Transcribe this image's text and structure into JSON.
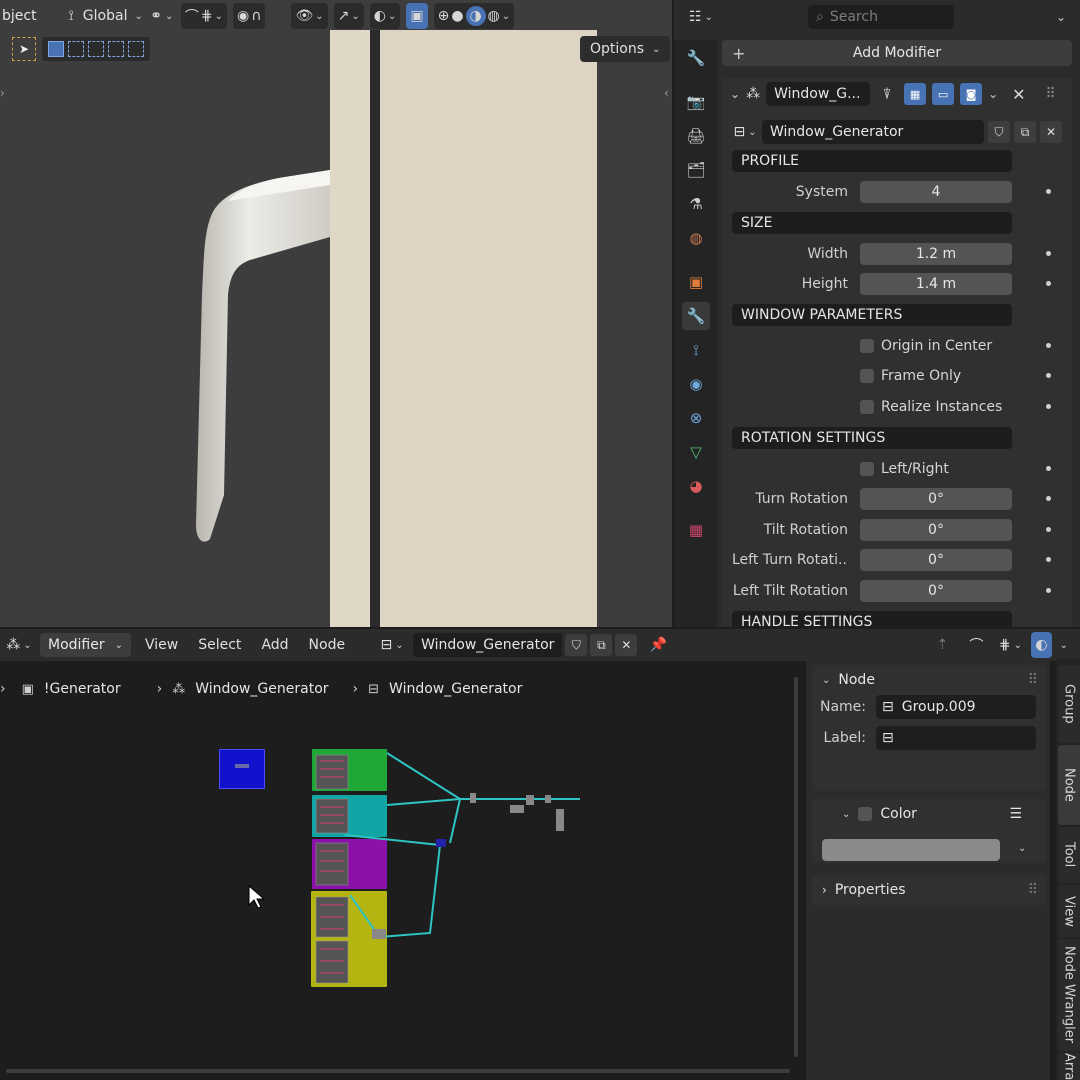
{
  "viewport": {
    "mode_label": "bject",
    "orientation": "Global",
    "options_label": "Options"
  },
  "properties": {
    "search_placeholder": "Search",
    "add_modifier_label": "Add Modifier",
    "modifier_name": "Window_G...",
    "node_group": "Window_Generator",
    "sections": [
      {
        "title": "PROFILE",
        "rows": [
          {
            "label": "System",
            "value": "4",
            "type": "number"
          }
        ]
      },
      {
        "title": "SIZE",
        "rows": [
          {
            "label": "Width",
            "value": "1.2 m",
            "type": "number"
          },
          {
            "label": "Height",
            "value": "1.4 m",
            "type": "number"
          }
        ]
      },
      {
        "title": "WINDOW PARAMETERS",
        "rows": [
          {
            "label": "Origin in Center",
            "type": "checkbox"
          },
          {
            "label": "Frame Only",
            "type": "checkbox"
          },
          {
            "label": "Realize Instances",
            "type": "checkbox"
          }
        ]
      },
      {
        "title": "ROTATION SETTINGS",
        "rows": [
          {
            "label": "Left/Right",
            "type": "checkbox"
          },
          {
            "label": "Turn Rotation",
            "value": "0°",
            "type": "number"
          },
          {
            "label": "Tilt Rotation",
            "value": "0°",
            "type": "number"
          },
          {
            "label": "Left Turn Rotati...",
            "value": "0°",
            "type": "number"
          },
          {
            "label": "Left Tilt Rotation",
            "value": "0°",
            "type": "number"
          }
        ]
      },
      {
        "title": "HANDLE SETTINGS",
        "rows": []
      }
    ]
  },
  "node_editor": {
    "editor_type": "Modifier",
    "menus": [
      "View",
      "Select",
      "Add",
      "Node"
    ],
    "node_group": "Window_Generator",
    "breadcrumb": [
      "!Generator",
      "Window_Generator",
      "Window_Generator"
    ],
    "sidebar": {
      "node_panel_title": "Node",
      "name_label": "Name:",
      "name_value": "Group.009",
      "label_label": "Label:",
      "label_value": "",
      "color_label": "Color",
      "properties_label": "Properties"
    },
    "tabs": [
      "Group",
      "Node",
      "Tool",
      "View",
      "Node Wrangler",
      "Arrang"
    ],
    "frame_colors": [
      "#1212cc",
      "#1fa836",
      "#12a5a5",
      "#8a12a8",
      "#b5b512"
    ]
  }
}
